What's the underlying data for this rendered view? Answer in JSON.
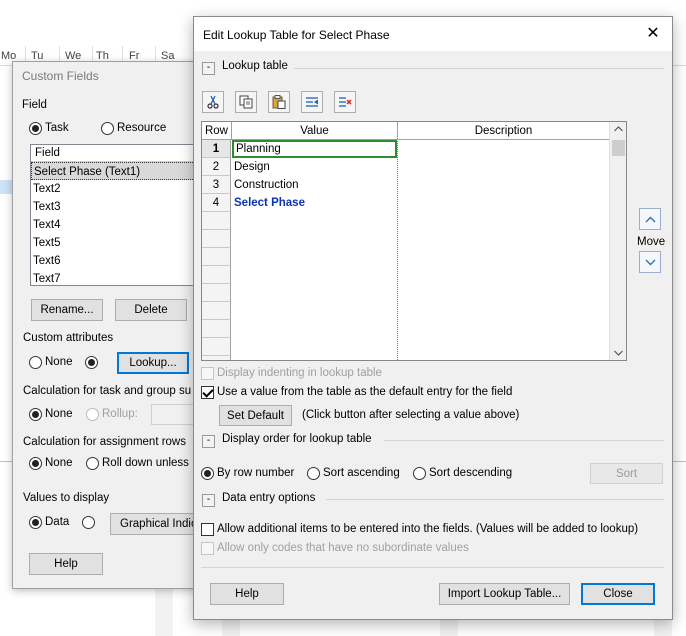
{
  "background": {
    "timescale_days": [
      "Mo",
      "Tu",
      "We",
      "Th",
      "Fr",
      "Sa"
    ]
  },
  "custom_fields": {
    "title": "Custom Fields",
    "field_label": "Field",
    "task_label": "Task",
    "resource_label": "Resource",
    "list_header": "Field",
    "fields": [
      "Select Phase (Text1)",
      "Text2",
      "Text3",
      "Text4",
      "Text5",
      "Text6",
      "Text7"
    ],
    "rename_label": "Rename...",
    "delete_label": "Delete",
    "custom_attributes_label": "Custom attributes",
    "none_label": "None",
    "lookup_label": "Lookup...",
    "calc_task_label": "Calculation for task and group su",
    "rollup_label": "Rollup:",
    "calc_assign_label": "Calculation for assignment rows",
    "rolldown_label": "Roll down unless",
    "values_display_label": "Values to display",
    "data_label": "Data",
    "graphical_label": "Graphical Indic",
    "help_label": "Help"
  },
  "lookup": {
    "title": "Edit Lookup Table for Select Phase",
    "close_glyph": "✕",
    "section_lookup": "Lookup table",
    "collapse_glyph": "-",
    "toolbar": [
      "cut-icon",
      "copy-icon",
      "paste-icon",
      "insert-row-icon",
      "delete-row-icon"
    ],
    "columns": {
      "row": "Row",
      "value": "Value",
      "description": "Description"
    },
    "rows": [
      {
        "row": "1",
        "value": "Planning",
        "description": ""
      },
      {
        "row": "2",
        "value": "Design",
        "description": ""
      },
      {
        "row": "3",
        "value": "Construction",
        "description": ""
      },
      {
        "row": "4",
        "value": "Select Phase",
        "description": ""
      }
    ],
    "move_label": "Move",
    "display_indenting_label": "Display indenting in lookup table",
    "use_default_label": "Use a value from the table as the default entry for the field",
    "set_default_label": "Set Default",
    "set_default_hint": "(Click button after selecting a value above)",
    "section_display_order": "Display order for lookup table",
    "by_row_label": "By row number",
    "sort_asc_label": "Sort ascending",
    "sort_desc_label": "Sort descending",
    "sort_label": "Sort",
    "section_data_entry": "Data entry options",
    "allow_additional_label": "Allow additional items to be entered into the fields. (Values will be added to lookup)",
    "allow_codes_label": "Allow only codes that have no subordinate values",
    "help_label": "Help",
    "import_label": "Import Lookup Table...",
    "close_label": "Close"
  }
}
